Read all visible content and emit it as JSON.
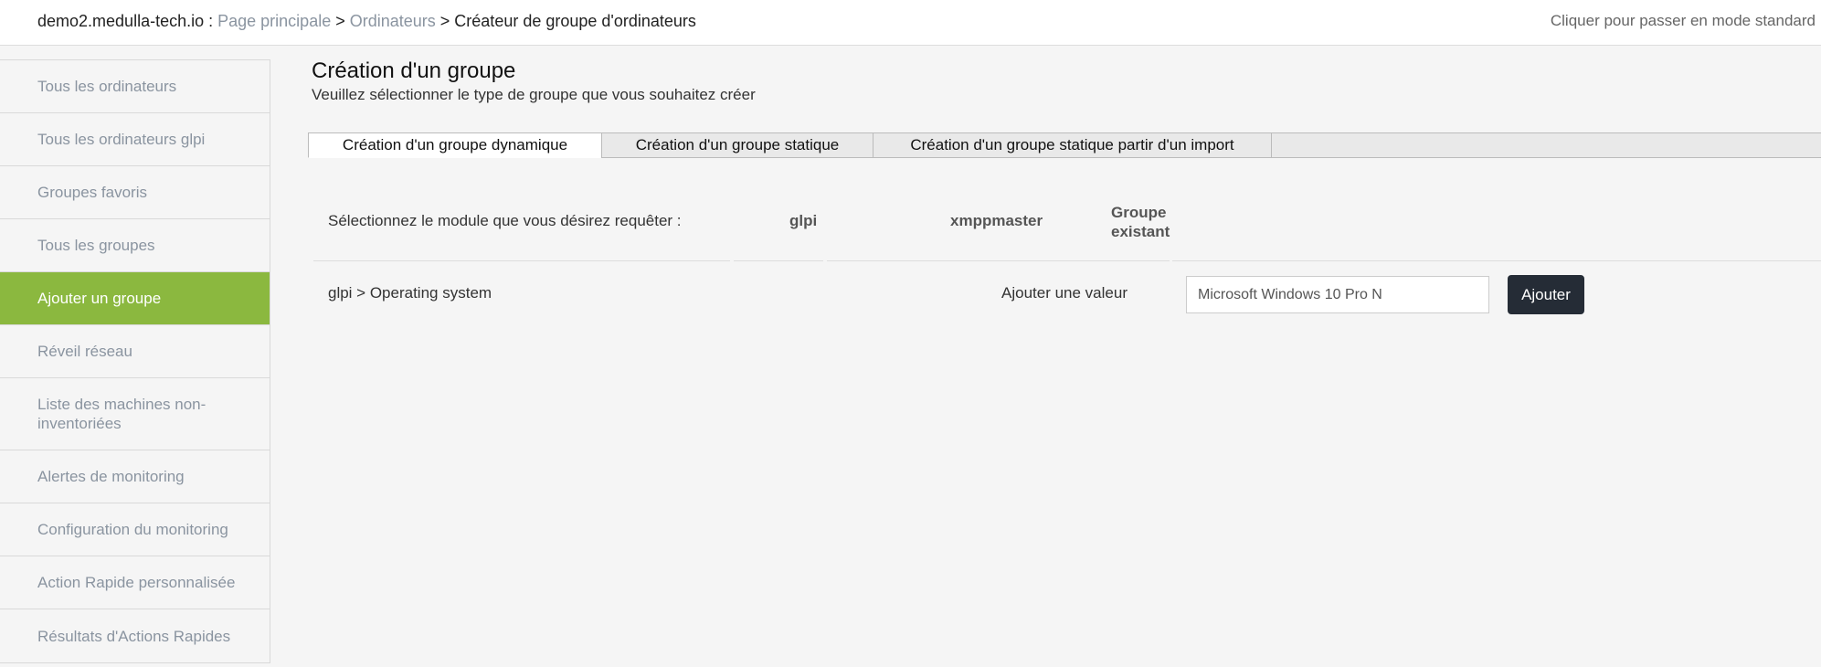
{
  "header": {
    "site": "demo2.medulla-tech.io",
    "site_suffix": " : ",
    "crumbs": [
      "Page principale",
      "Ordinateurs"
    ],
    "current": "Créateur de groupe d'ordinateurs",
    "separator": " > ",
    "mode_link": "Cliquer pour passer en mode standard"
  },
  "sidebar": {
    "items": [
      {
        "label": "Tous les ordinateurs"
      },
      {
        "label": "Tous les ordinateurs glpi"
      },
      {
        "label": "Groupes favoris"
      },
      {
        "label": "Tous les groupes"
      },
      {
        "label": "Ajouter un groupe",
        "active": true
      },
      {
        "label": "Réveil réseau"
      },
      {
        "label": "Liste des machines non-inventoriées"
      },
      {
        "label": "Alertes de monitoring"
      },
      {
        "label": "Configuration du monitoring"
      },
      {
        "label": "Action Rapide personnalisée"
      },
      {
        "label": "Résultats d'Actions Rapides"
      }
    ]
  },
  "main": {
    "title": "Création d'un groupe",
    "subtitle": "Veuillez sélectionner le type de groupe que vous souhaitez créer",
    "tabs": [
      {
        "label": "Création d'un groupe dynamique",
        "active": true
      },
      {
        "label": "Création d'un groupe statique"
      },
      {
        "label": "Création d'un groupe statique partir d'un import"
      }
    ],
    "module_prompt": "Sélectionnez le module que vous désirez requêter :",
    "modules": [
      "glpi",
      "xmppmaster",
      "Groupe existant"
    ],
    "criterion": "glpi > Operating system",
    "add_value_label": "Ajouter une valeur",
    "value_input": "Microsoft Windows 10 Pro N",
    "add_button": "Ajouter"
  }
}
